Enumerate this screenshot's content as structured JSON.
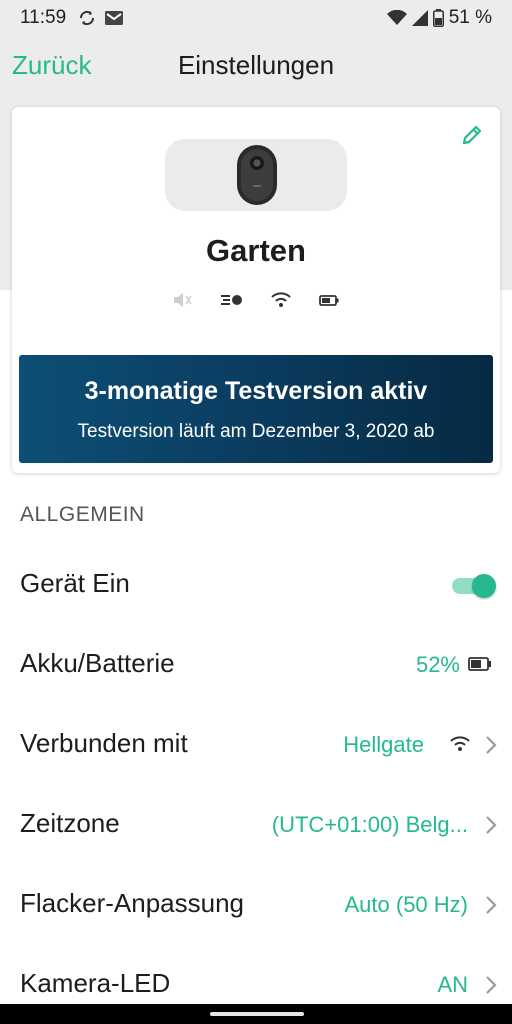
{
  "status_bar": {
    "time": "11:59",
    "battery_percent": "51 %",
    "icons": [
      "sync-icon",
      "gmail-icon",
      "wifi-icon",
      "signal-icon",
      "battery-icon"
    ]
  },
  "header": {
    "back_label": "Zurück",
    "title": "Einstellungen"
  },
  "device": {
    "name": "Garten",
    "status_icons": [
      "speaker-muted-icon",
      "motion-sensor-icon",
      "wifi-icon",
      "battery-icon"
    ]
  },
  "trial": {
    "title": "3-monatige Testversion aktiv",
    "subtitle": "Testversion läuft am Dezember 3, 2020 ab"
  },
  "section": {
    "heading": "ALLGEMEIN"
  },
  "settings": [
    {
      "label": "Gerät Ein",
      "value": "",
      "toggle_on": true
    },
    {
      "label": "Akku/Batterie",
      "value": "52%"
    },
    {
      "label": "Verbunden mit",
      "value": "Hellgate"
    },
    {
      "label": "Zeitzone",
      "value": "(UTC+01:00) Belg..."
    },
    {
      "label": "Flacker-Anpassung",
      "value": "Auto (50 Hz)"
    },
    {
      "label": "Kamera-LED",
      "value": "AN"
    }
  ],
  "colors": {
    "accent": "#26b98f",
    "banner_dark": "#062a43",
    "banner_light": "#0d4f76",
    "header_bg": "#ececec"
  }
}
